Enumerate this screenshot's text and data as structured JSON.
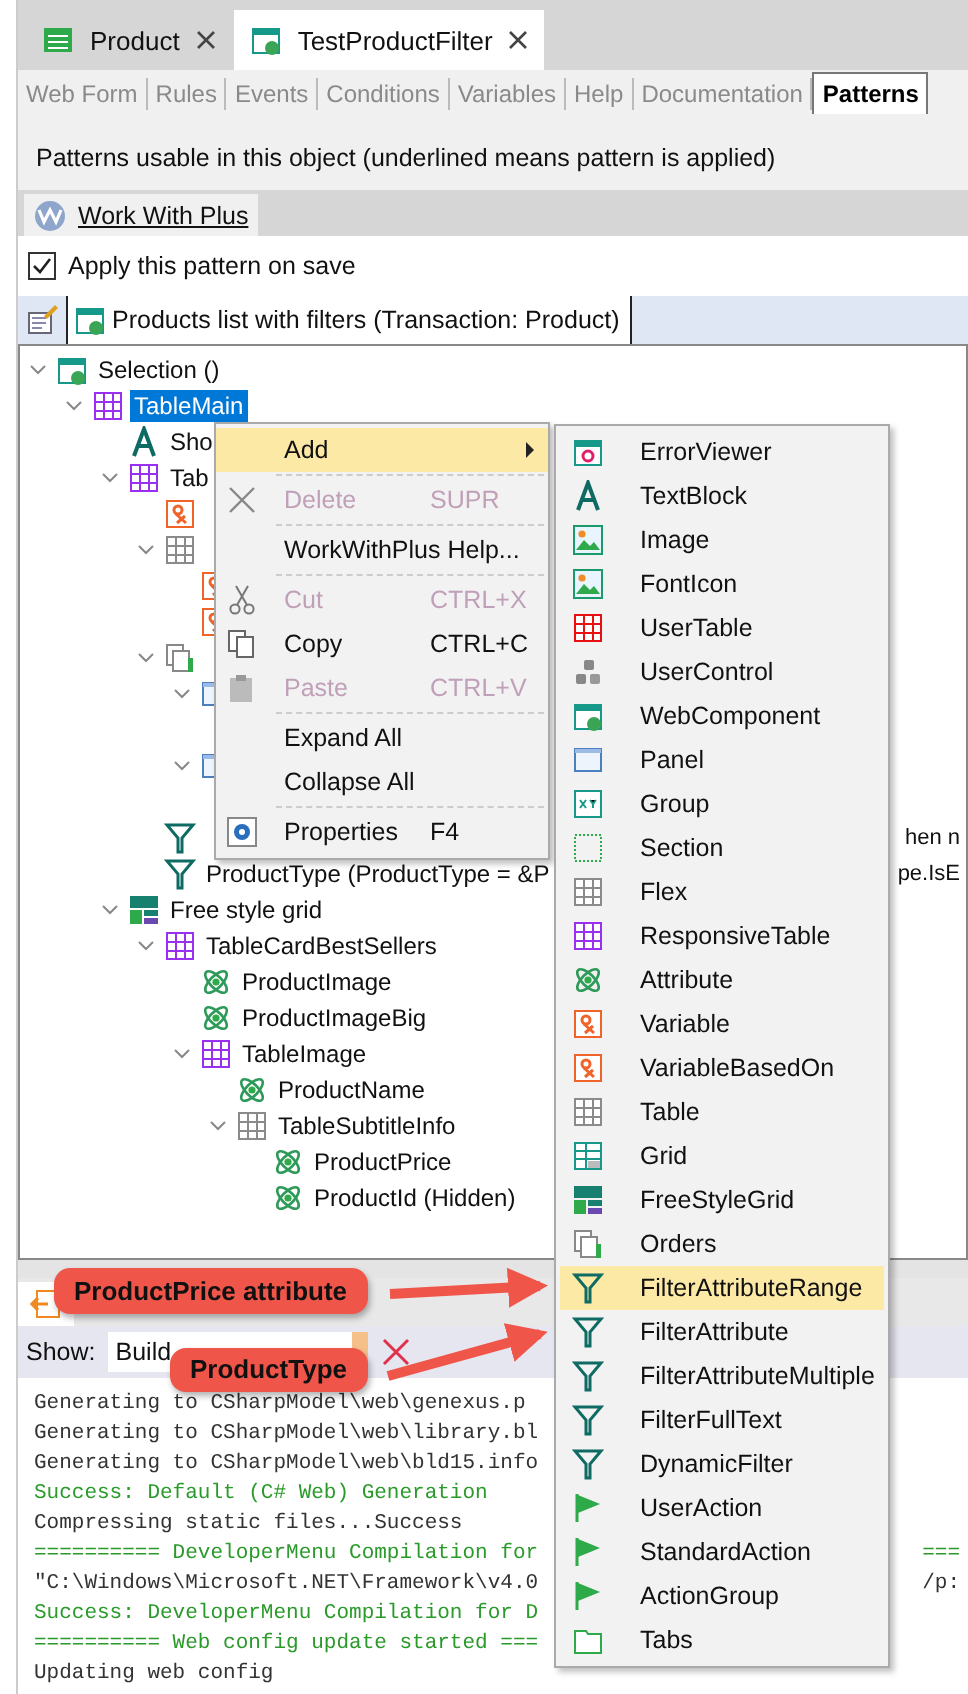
{
  "doc_tabs": [
    {
      "label": "Product",
      "kind": "spreadsheet",
      "selected": false
    },
    {
      "label": "TestProductFilter",
      "kind": "webcomp",
      "selected": true
    }
  ],
  "editor_tabs": [
    {
      "label": "Web Form",
      "selected": false
    },
    {
      "label": "Rules",
      "selected": false
    },
    {
      "label": "Events",
      "selected": false
    },
    {
      "label": "Conditions",
      "selected": false
    },
    {
      "label": "Variables",
      "selected": false
    },
    {
      "label": "Help",
      "selected": false
    },
    {
      "label": "Documentation",
      "selected": false
    },
    {
      "label": "Patterns",
      "selected": true
    }
  ],
  "patterns_note": "Patterns usable in this object (underlined means pattern is applied)",
  "pattern_tabs": [
    {
      "label": "Work With Plus",
      "selected": true,
      "applied": true
    }
  ],
  "apply_on_save": {
    "label": "Apply this pattern on save",
    "checked": true
  },
  "instance_tab": {
    "label": "Products list with filters (Transaction: Product)"
  },
  "tree": [
    {
      "label": "Selection ()",
      "kind": "webcomp",
      "expanded": true,
      "selected": false,
      "children": [
        {
          "label": "TableMain",
          "kind": "table_purple",
          "expanded": true,
          "selected": true,
          "children": [
            {
              "label": "Sho",
              "kind": "textblock",
              "selected": false
            },
            {
              "label": "Tab",
              "kind": "table_purple",
              "expanded": true,
              "selected": false,
              "children": [
                {
                  "kind": "variable",
                  "selected": false
                },
                {
                  "kind": "table",
                  "expanded": true,
                  "selected": false,
                  "children": [
                    {
                      "kind": "variable",
                      "selected": false
                    },
                    {
                      "kind": "variable",
                      "selected": false
                    }
                  ]
                },
                {
                  "kind": "orders",
                  "expanded": true,
                  "selected": false,
                  "children": [
                    {
                      "kind": "panel",
                      "expanded": true,
                      "selected": false
                    },
                    {
                      "kind": "panel",
                      "expanded": true,
                      "selected": false
                    }
                  ]
                },
                {
                  "kind": "filter",
                  "tail": "hen n",
                  "selected": false
                },
                {
                  "label": "ProductType (ProductType = &P",
                  "kind": "filter",
                  "tail": "pe.IsE",
                  "selected": false
                }
              ]
            },
            {
              "label": "Free style grid",
              "kind": "freestylegrid",
              "expanded": true,
              "selected": false,
              "children": [
                {
                  "label": "TableCardBestSellers",
                  "kind": "table_purple",
                  "expanded": true,
                  "selected": false,
                  "children": [
                    {
                      "label": "ProductImage",
                      "kind": "attribute",
                      "selected": false
                    },
                    {
                      "label": "ProductImageBig",
                      "kind": "attribute",
                      "selected": false
                    },
                    {
                      "label": "TableImage",
                      "kind": "table_purple",
                      "expanded": true,
                      "selected": false,
                      "children": [
                        {
                          "label": "ProductName",
                          "kind": "attribute",
                          "selected": false
                        },
                        {
                          "label": "TableSubtitleInfo",
                          "kind": "table",
                          "expanded": true,
                          "selected": false,
                          "children": [
                            {
                              "label": "ProductPrice",
                              "kind": "attribute",
                              "selected": false
                            },
                            {
                              "label": "ProductId (Hidden)",
                              "kind": "attribute",
                              "selected": false
                            }
                          ]
                        }
                      ]
                    }
                  ]
                }
              ]
            }
          ]
        }
      ]
    }
  ],
  "context_menu": {
    "groups": [
      [
        {
          "label": "Add",
          "submenu": true,
          "selected": true,
          "disabled": false
        }
      ],
      [
        {
          "label": "Delete",
          "kind": "delete",
          "shortcut": "SUPR",
          "selected": false,
          "disabled": true
        }
      ],
      [
        {
          "label": "WorkWithPlus Help...",
          "selected": false,
          "disabled": false
        }
      ],
      [
        {
          "label": "Cut",
          "kind": "cut",
          "shortcut": "CTRL+X",
          "selected": false,
          "disabled": true
        },
        {
          "label": "Copy",
          "kind": "copy",
          "shortcut": "CTRL+C",
          "selected": false,
          "disabled": false
        },
        {
          "label": "Paste",
          "kind": "paste",
          "shortcut": "CTRL+V",
          "selected": false,
          "disabled": true
        }
      ],
      [
        {
          "label": "Expand All",
          "selected": false,
          "disabled": false
        },
        {
          "label": "Collapse All",
          "selected": false,
          "disabled": false
        }
      ],
      [
        {
          "label": "Properties",
          "kind": "properties",
          "shortcut": "F4",
          "selected": false,
          "disabled": false
        }
      ]
    ]
  },
  "add_submenu": {
    "items": [
      {
        "label": "ErrorViewer",
        "kind": "errorviewer",
        "selected": false
      },
      {
        "label": "TextBlock",
        "kind": "textblock",
        "selected": false
      },
      {
        "label": "Image",
        "kind": "image",
        "selected": false
      },
      {
        "label": "FontIcon",
        "kind": "image",
        "selected": false
      },
      {
        "label": "UserTable",
        "kind": "table_red",
        "selected": false
      },
      {
        "label": "UserControl",
        "kind": "usercontrol",
        "selected": false
      },
      {
        "label": "WebComponent",
        "kind": "webcomp",
        "selected": false
      },
      {
        "label": "Panel",
        "kind": "panel",
        "selected": false
      },
      {
        "label": "Group",
        "kind": "group",
        "selected": false
      },
      {
        "label": "Section",
        "kind": "section",
        "selected": false
      },
      {
        "label": "Flex",
        "kind": "table",
        "selected": false
      },
      {
        "label": "ResponsiveTable",
        "kind": "table_purple",
        "selected": false
      },
      {
        "label": "Attribute",
        "kind": "attribute",
        "selected": false
      },
      {
        "label": "Variable",
        "kind": "variable",
        "selected": false
      },
      {
        "label": "VariableBasedOn",
        "kind": "variable",
        "selected": false
      },
      {
        "label": "Table",
        "kind": "table",
        "selected": false
      },
      {
        "label": "Grid",
        "kind": "grid",
        "selected": false
      },
      {
        "label": "FreeStyleGrid",
        "kind": "freestylegrid",
        "selected": false
      },
      {
        "label": "Orders",
        "kind": "orders",
        "selected": false
      },
      {
        "label": "FilterAttributeRange",
        "kind": "filter",
        "selected": true
      },
      {
        "label": "FilterAttribute",
        "kind": "filter",
        "selected": false
      },
      {
        "label": "FilterAttributeMultiple",
        "kind": "filter",
        "selected": false
      },
      {
        "label": "FilterFullText",
        "kind": "filter",
        "selected": false
      },
      {
        "label": "DynamicFilter",
        "kind": "filter",
        "selected": false
      },
      {
        "label": "UserAction",
        "kind": "action",
        "selected": false
      },
      {
        "label": "StandardAction",
        "kind": "action",
        "selected": false
      },
      {
        "label": "ActionGroup",
        "kind": "action",
        "selected": false
      },
      {
        "label": "Tabs",
        "kind": "tabs",
        "selected": false
      }
    ]
  },
  "output": {
    "show_label": "Show:",
    "show_value": "Build",
    "lines": [
      {
        "text": "Generating to CSharpModel\\web\\genexus.p",
        "kind": "info"
      },
      {
        "text": "Generating to CSharpModel\\web\\library.bl",
        "kind": "info"
      },
      {
        "text": "Generating to CSharpModel\\web\\bld15.info",
        "kind": "info"
      },
      {
        "text": "Success: Default (C# Web) Generation",
        "kind": "success"
      },
      {
        "text": "Compressing static files...Success",
        "kind": "info"
      },
      {
        "text": "========== DeveloperMenu Compilation for",
        "kind": "success",
        "tail": "==="
      },
      {
        "text": "\"C:\\Windows\\Microsoft.NET\\Framework\\v4.0",
        "kind": "info",
        "tail": "/p:"
      },
      {
        "text": "Success: DeveloperMenu Compilation for D",
        "kind": "success"
      },
      {
        "text": "========== Web config update started ===",
        "kind": "success"
      },
      {
        "text": "Updating web config",
        "kind": "info"
      }
    ]
  },
  "callouts": [
    {
      "text": "ProductPrice attribute"
    },
    {
      "text": "ProductType"
    }
  ]
}
